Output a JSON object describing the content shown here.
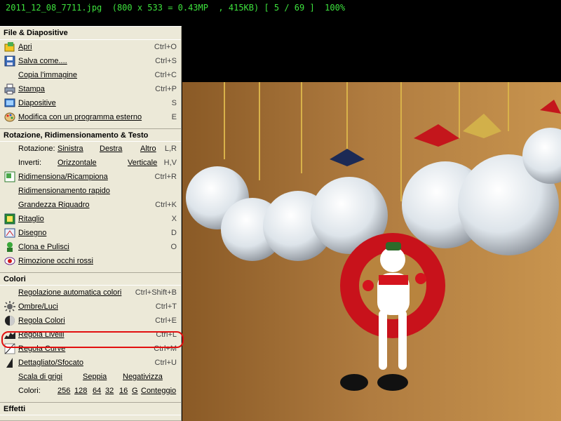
{
  "title_bar": "2011_12_08_7711.jpg  (800 x 533 = 0.43MP  , 415KB) [ 5 / 69 ]  100%",
  "menu": {
    "sections": {
      "file": "File & Diapositive",
      "rotation": "Rotazione, Ridimensionamento  & Testo",
      "colors": "Colori",
      "effects": "Effetti"
    },
    "file_items": [
      {
        "label": "Apri",
        "shortcut": "Ctrl+O",
        "icon": "open-folder-icon"
      },
      {
        "label": "Salva come....",
        "shortcut": "Ctrl+S",
        "icon": "floppy-disk-icon"
      },
      {
        "label": "Copia l'immagine",
        "shortcut": "Ctrl+C",
        "icon": ""
      },
      {
        "label": "Stampa",
        "shortcut": "Ctrl+P",
        "icon": "printer-icon"
      },
      {
        "label": "Diapositive",
        "shortcut": "S",
        "icon": "slideshow-icon"
      },
      {
        "label": "Modifica con un programma esterno",
        "shortcut": "E",
        "icon": "palette-icon"
      }
    ],
    "rotation": {
      "label": "Rotazione:",
      "left": "Sinistra",
      "right": "Destra",
      "other": "Altro",
      "shortcut": "L,R"
    },
    "invert": {
      "label": "Inverti:",
      "horizontal": "Orizzontale",
      "vertical": "Verticale",
      "shortcut": "H,V"
    },
    "resize_items": [
      {
        "label": "Ridimensiona/Ricampiona",
        "shortcut": "Ctrl+R",
        "icon": "resize-icon"
      },
      {
        "label": "Ridimensionamento rapido",
        "shortcut": "",
        "icon": ""
      },
      {
        "label": "Grandezza Riquadro",
        "shortcut": "Ctrl+K",
        "icon": ""
      },
      {
        "label": "Ritaglio",
        "shortcut": "X",
        "icon": "crop-icon"
      },
      {
        "label": "Disegno",
        "shortcut": "D",
        "icon": "draw-icon"
      },
      {
        "label": "Clona e Pulisci",
        "shortcut": "O",
        "icon": "clone-icon"
      },
      {
        "label": "Rimozione occhi rossi",
        "shortcut": "",
        "icon": "red-eye-icon"
      }
    ],
    "color_items": [
      {
        "label": "Regolazione automatica colori",
        "shortcut": "Ctrl+Shift+B",
        "icon": ""
      },
      {
        "label": "Ombre/Luci",
        "shortcut": "Ctrl+T",
        "icon": "sun-icon"
      },
      {
        "label": "Regola Colori",
        "shortcut": "Ctrl+E",
        "icon": "color-wheel-icon"
      },
      {
        "label": "Regola Livelli",
        "shortcut": "Ctrl+L",
        "icon": "levels-icon"
      },
      {
        "label": "Regola Curve",
        "shortcut": "Ctrl+M",
        "icon": "curves-icon"
      },
      {
        "label": "Dettagliato/Sfocato",
        "shortcut": "Ctrl+U",
        "icon": "sharpen-icon"
      }
    ],
    "grayscale": {
      "grayscale": "Scala di grigi",
      "sepia": "Seppia",
      "negative": "Negativizza"
    },
    "colors_row": {
      "label": "Colori:",
      "options": [
        "256",
        "128",
        "64",
        "32",
        "16",
        "G"
      ],
      "count": "Conteggio"
    }
  }
}
